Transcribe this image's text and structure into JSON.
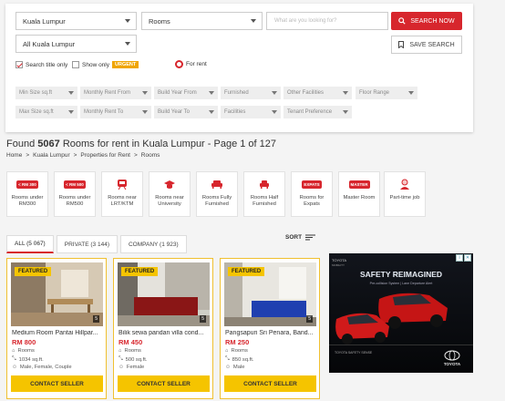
{
  "filters": {
    "location": "Kuala Lumpur",
    "property_type": "Rooms",
    "area": "All Kuala Lumpur",
    "search_placeholder": "What are you looking for?",
    "search_button": "SEARCH NOW",
    "save_button": "SAVE SEARCH",
    "search_title_only": "Search title only",
    "show_only": "Show only",
    "urgent": "URGENT",
    "for_rent": "For rent",
    "row1": [
      "Min Size sq.ft",
      "Monthly Rent From",
      "Build Year From",
      "Furnished",
      "Other Facilities",
      "Floor Range"
    ],
    "row2": [
      "Max Size sq.ft",
      "Monthly Rent To",
      "Build Year To",
      "Facilities",
      "Tenant Preference"
    ]
  },
  "results": {
    "found_prefix": "Found",
    "count": "5067",
    "rest": "Rooms for rent in Kuala Lumpur - Page 1 of 127",
    "breadcrumbs": [
      "Home",
      ">",
      "Kuala Lumpur",
      ">",
      "Properties for Rent",
      ">",
      "Rooms"
    ]
  },
  "categories": [
    {
      "line1": "Rooms under",
      "line2": "RM300",
      "badge": "< RM 300"
    },
    {
      "line1": "Rooms under",
      "line2": "RM500",
      "badge": "< RM 500"
    },
    {
      "line1": "Rooms near",
      "line2": "LRT/KTM",
      "badge": ""
    },
    {
      "line1": "Rooms near",
      "line2": "University",
      "badge": ""
    },
    {
      "line1": "Rooms Fully",
      "line2": "Furnished",
      "badge": ""
    },
    {
      "line1": "Rooms Half",
      "line2": "Furnished",
      "badge": ""
    },
    {
      "line1": "Rooms for",
      "line2": "Expats",
      "badge": "EXPATS"
    },
    {
      "line1": "Master Room",
      "line2": "",
      "badge": "MASTER"
    },
    {
      "line1": "Part-time job",
      "line2": "",
      "badge": ""
    }
  ],
  "tabs": [
    "ALL (5 067)",
    "PRIVATE (3 144)",
    "COMPANY (1 923)"
  ],
  "sort_label": "SORT",
  "listings": [
    {
      "featured": "FEATURED",
      "photos": "5",
      "title": "Medium Room Pantai Hillpar...",
      "price": "RM 800",
      "type": "Rooms",
      "size": "1034 sq.ft.",
      "tenant": "Male, Female, Couple",
      "contact": "CONTACT SELLER"
    },
    {
      "featured": "FEATURED",
      "photos": "5",
      "title": "Bilik sewa pandan villa cond...",
      "price": "RM 450",
      "type": "Rooms",
      "size": "500 sq.ft.",
      "tenant": "Female",
      "contact": "CONTACT SELLER"
    },
    {
      "featured": "FEATURED",
      "photos": "5",
      "title": "Pangsapuri Sri Penara, Band...",
      "price": "RM 250",
      "type": "Rooms",
      "size": "850 sq.ft.",
      "tenant": "Male",
      "contact": "CONTACT SELLER"
    }
  ],
  "ad": {
    "headline": "SAFETY REIMAGINED",
    "sub": "Pre-collision System | Lane Departure Alert",
    "brand": "TOYOTA",
    "brand_sub": "TOYOTA MOBILITY",
    "tagline": "TOYOTA SAFETY SENSE"
  },
  "colors": {
    "accent": "#d7262d",
    "featured": "#f5c400",
    "urgent": "#f0a500"
  }
}
